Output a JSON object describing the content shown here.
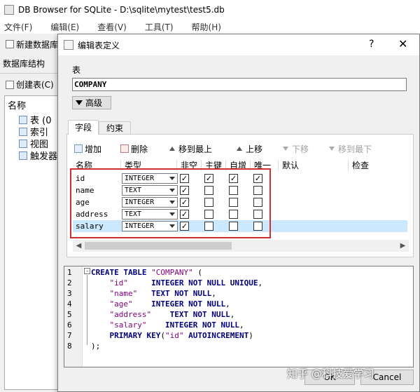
{
  "main_window": {
    "title": "DB Browser for SQLite - D:\\sqlite\\mytest\\test5.db",
    "menu": [
      "文件(F)",
      "编辑(E)",
      "查看(V)",
      "工具(T)",
      "帮助(H)"
    ],
    "toolbar_new_db": "新建数据库",
    "left_tab": "数据库结构",
    "create_table": "创建表(C)",
    "tree_header": "名称",
    "tree_items": [
      "表 (0",
      "索引",
      "视图",
      "触发器"
    ]
  },
  "dialog": {
    "title": "编辑表定义",
    "help": "?",
    "close": "✕",
    "table_label": "表",
    "table_name": "COMPANY",
    "advanced": "高级",
    "tabs": [
      "字段",
      "约束"
    ],
    "toolbar": {
      "add": "增加",
      "delete": "删除",
      "move_top": "移到最上",
      "move_up": "上移",
      "move_down": "下移",
      "move_bottom": "移到最下"
    },
    "columns": [
      "名称",
      "类型",
      "非空",
      "主键",
      "自增",
      "唯一",
      "默认",
      "检查"
    ],
    "fields": [
      {
        "name": "id",
        "type": "INTEGER",
        "not_null": true,
        "pk": true,
        "ai": true,
        "unique": true
      },
      {
        "name": "name",
        "type": "TEXT",
        "not_null": true,
        "pk": false,
        "ai": false,
        "unique": false
      },
      {
        "name": "age",
        "type": "INTEGER",
        "not_null": true,
        "pk": false,
        "ai": false,
        "unique": false
      },
      {
        "name": "address",
        "type": "TEXT",
        "not_null": true,
        "pk": false,
        "ai": false,
        "unique": false
      },
      {
        "name": "salary",
        "type": "INTEGER",
        "not_null": true,
        "pk": false,
        "ai": false,
        "unique": false
      }
    ],
    "sql_lines": [
      {
        "n": "1",
        "html": "<span class='kw'>CREATE TABLE</span> <span class='str'>\"COMPANY\"</span> ("
      },
      {
        "n": "2",
        "html": "    <span class='str'>\"id\"</span>     <span class='kw'>INTEGER NOT NULL UNIQUE</span>,"
      },
      {
        "n": "3",
        "html": "    <span class='str'>\"name\"</span>   <span class='kw'>TEXT NOT NULL</span>,"
      },
      {
        "n": "4",
        "html": "    <span class='str'>\"age\"</span>    <span class='kw'>INTEGER NOT NULL</span>,"
      },
      {
        "n": "5",
        "html": "    <span class='str'>\"address\"</span>    <span class='kw'>TEXT NOT NULL</span>,"
      },
      {
        "n": "6",
        "html": "    <span class='str'>\"salary\"</span>    <span class='kw'>INTEGER NOT NULL</span>,"
      },
      {
        "n": "7",
        "html": "    <span class='kw'>PRIMARY KEY</span>(<span class='str'>\"id\"</span> <span class='kw'>AUTOINCREMENT</span>)"
      },
      {
        "n": "8",
        "html": ");"
      }
    ],
    "ok": "OK",
    "cancel": "Cancel"
  },
  "watermark": "知乎 @科技爱学习",
  "colors": {
    "highlight_box": "#d03030",
    "selected_row": "#cce8ff"
  }
}
